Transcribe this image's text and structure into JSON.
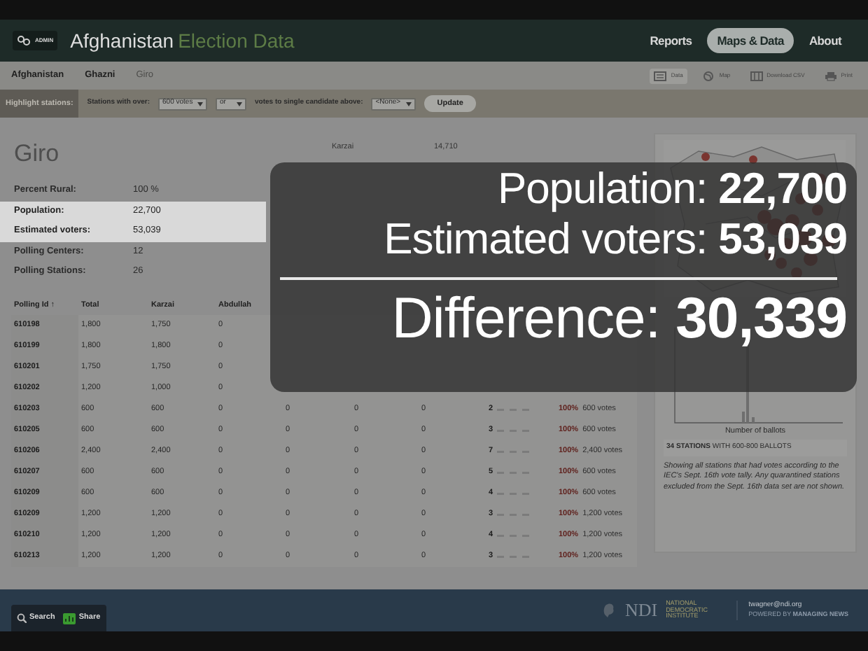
{
  "header": {
    "logo_badge": "ADMIN",
    "title": "Afghanistan",
    "subtitle": "Election Data",
    "nav": [
      {
        "label": "Reports",
        "selected": false
      },
      {
        "label": "Maps & Data",
        "selected": true
      },
      {
        "label": "About",
        "selected": false
      }
    ]
  },
  "breadcrumb": [
    {
      "label": "Afghanistan",
      "current": false
    },
    {
      "label": "Ghazni",
      "current": false
    },
    {
      "label": "Giro",
      "current": true
    }
  ],
  "view_tools": [
    {
      "label": "Data",
      "kind": "data",
      "selected": true
    },
    {
      "label": "Map",
      "kind": "map",
      "selected": false
    },
    {
      "label": "Download CSV",
      "kind": "csv",
      "selected": false
    },
    {
      "label": "Print",
      "kind": "print",
      "selected": false
    }
  ],
  "highlight_bar": {
    "label": "Highlight stations:",
    "text_1": "Stations with over:",
    "select_1": "600 votes",
    "select_2": "or",
    "text_2": "votes to single candidate above:",
    "select_3": "<None>",
    "button": "Update"
  },
  "district": {
    "name": "Giro",
    "stats": [
      {
        "label": "Percent Rural:",
        "value": "100 %",
        "highlighted": false
      },
      {
        "label": "Population:",
        "value": "22,700",
        "highlighted": true
      },
      {
        "label": "Estimated voters:",
        "value": "53,039",
        "highlighted": true
      },
      {
        "label": "Polling Centers:",
        "value": "12",
        "highlighted": false
      },
      {
        "label": "Polling Stations:",
        "value": "26",
        "highlighted": false
      }
    ]
  },
  "candidates": [
    {
      "name": "Karzai",
      "votes": "14,710"
    }
  ],
  "table": {
    "columns": [
      "Polling Id ↑",
      "Total",
      "Karzai",
      "Abdullah"
    ],
    "rows": [
      {
        "cells": [
          "610198",
          "1,800",
          "1,750",
          "0"
        ]
      },
      {
        "cells": [
          "610199",
          "1,800",
          "1,800",
          "0"
        ]
      },
      {
        "cells": [
          "610201",
          "1,750",
          "1,750",
          "0"
        ]
      },
      {
        "cells": [
          "610202",
          "1,200",
          "1,000",
          "0"
        ]
      },
      {
        "cells": [
          "610203",
          "600",
          "600",
          "0",
          "0",
          "0",
          "0"
        ],
        "stations": "2",
        "share": "100%",
        "votes": "600 votes"
      },
      {
        "cells": [
          "610205",
          "600",
          "600",
          "0",
          "0",
          "0",
          "0"
        ],
        "stations": "3",
        "share": "100%",
        "votes": "600 votes"
      },
      {
        "cells": [
          "610206",
          "2,400",
          "2,400",
          "0",
          "0",
          "0",
          "0"
        ],
        "stations": "7",
        "share": "100%",
        "votes": "2,400 votes"
      },
      {
        "cells": [
          "610207",
          "600",
          "600",
          "0",
          "0",
          "0",
          "0"
        ],
        "stations": "5",
        "share": "100%",
        "votes": "600 votes"
      },
      {
        "cells": [
          "610209",
          "600",
          "600",
          "0",
          "0",
          "0",
          "0"
        ],
        "stations": "4",
        "share": "100%",
        "votes": "600 votes"
      },
      {
        "cells": [
          "610209",
          "1,200",
          "1,200",
          "0",
          "0",
          "0",
          "0"
        ],
        "stations": "3",
        "share": "100%",
        "votes": "1,200 votes"
      },
      {
        "cells": [
          "610210",
          "1,200",
          "1,200",
          "0",
          "0",
          "0",
          "0"
        ],
        "stations": "4",
        "share": "100%",
        "votes": "1,200 votes"
      },
      {
        "cells": [
          "610213",
          "1,200",
          "1,200",
          "0",
          "0",
          "0",
          "0"
        ],
        "stations": "3",
        "share": "100%",
        "votes": "1,200 votes"
      }
    ]
  },
  "side_panel": {
    "xlabel": "Number of ballots",
    "summary": "**34 STATIONS** WITH 600-800 BALLOTS",
    "note": "Showing all stations that had votes according to the IEC's Sept. 16th vote tally. Any quarantined stations excluded from the Sept. 16th data set are not shown."
  },
  "overlay": {
    "lines": [
      {
        "label": "Population:",
        "value": "22,700",
        "kind": "figure"
      },
      {
        "label": "Estimated voters:",
        "value": "53,039",
        "kind": "figure"
      },
      {
        "label": "Difference:",
        "value": "30,339",
        "kind": "total"
      }
    ]
  },
  "footer": {
    "buttons": [
      {
        "label": "Search",
        "kind": "search"
      },
      {
        "label": "Share",
        "kind": "share"
      }
    ],
    "org_logo": "NDI",
    "org_name": "NATIONAL DEMOCRATIC INSTITUTE",
    "email": "twagner@ndi.org",
    "powered_by": "POWERED BY **MANAGING NEWS**"
  }
}
